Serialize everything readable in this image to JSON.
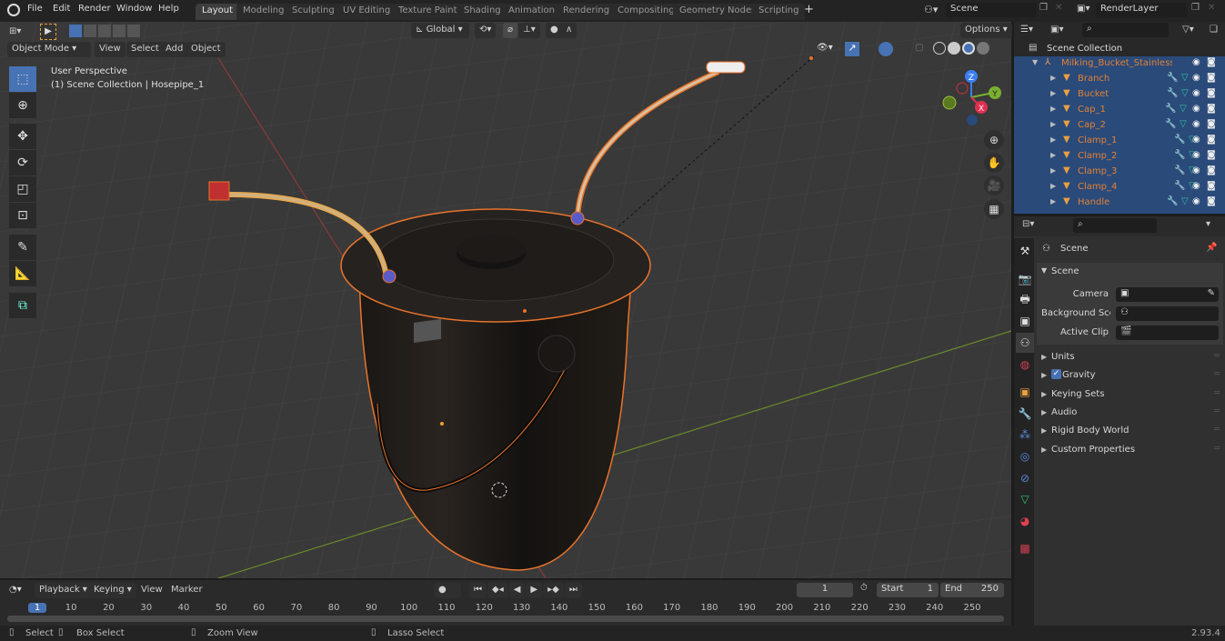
{
  "topbar": {
    "menus": [
      "File",
      "Edit",
      "Render",
      "Window",
      "Help"
    ],
    "workspaces": [
      "Layout",
      "Modeling",
      "Sculpting",
      "UV Editing",
      "Texture Paint",
      "Shading",
      "Animation",
      "Rendering",
      "Compositing",
      "Geometry Nodes",
      "Scripting"
    ],
    "active_workspace": "Layout",
    "add_workspace": "+",
    "scene": "Scene",
    "view_layer": "RenderLayer"
  },
  "viewport_header": {
    "mode": "Object Mode",
    "menus": [
      "View",
      "Select",
      "Add",
      "Object"
    ],
    "transform_orientation": "Global",
    "options": "Options"
  },
  "viewport": {
    "perspective": "User Perspective",
    "context": "(1) Scene Collection | Hosepipe_1",
    "gizmo_axes": [
      "X",
      "Y",
      "Z"
    ]
  },
  "tools": [
    "select-box",
    "cursor",
    "move",
    "rotate",
    "scale",
    "transform",
    "annotate",
    "measure",
    "add-cube"
  ],
  "outliner": {
    "root": "Scene Collection",
    "parent": "Milking_Bucket_Stainless_Ste",
    "items": [
      "Branch",
      "Bucket",
      "Cap_1",
      "Cap_2",
      "Clamp_1",
      "Clamp_2",
      "Clamp_3",
      "Clamp_4",
      "Handle"
    ]
  },
  "properties": {
    "header": "Scene",
    "panel": "Scene",
    "fields": [
      {
        "label": "Camera",
        "value": ""
      },
      {
        "label": "Background Sce...",
        "value": ""
      },
      {
        "label": "Active Clip",
        "value": ""
      }
    ],
    "sections": [
      "Units",
      "Gravity",
      "Keying Sets",
      "Audio",
      "Rigid Body World",
      "Custom Properties"
    ],
    "gravity_checked": true
  },
  "timeline": {
    "menus": [
      "Playback",
      "Keying",
      "View",
      "Marker"
    ],
    "current_frame": "1",
    "start_label": "Start",
    "start": "1",
    "end_label": "End",
    "end": "250",
    "ticks": [
      "1",
      "10",
      "20",
      "30",
      "40",
      "50",
      "60",
      "70",
      "80",
      "90",
      "100",
      "110",
      "120",
      "130",
      "140",
      "150",
      "160",
      "170",
      "180",
      "190",
      "200",
      "210",
      "220",
      "230",
      "240",
      "250"
    ]
  },
  "statusbar": {
    "select": "Select",
    "box_select": "Box Select",
    "zoom_view": "Zoom View",
    "lasso_select": "Lasso Select",
    "version": "2.93.4"
  },
  "colors": {
    "accent": "#4772b3",
    "selection_outline": "#e8742c",
    "outliner_selected": "#2a4a7a",
    "object_name": "#e48234"
  }
}
